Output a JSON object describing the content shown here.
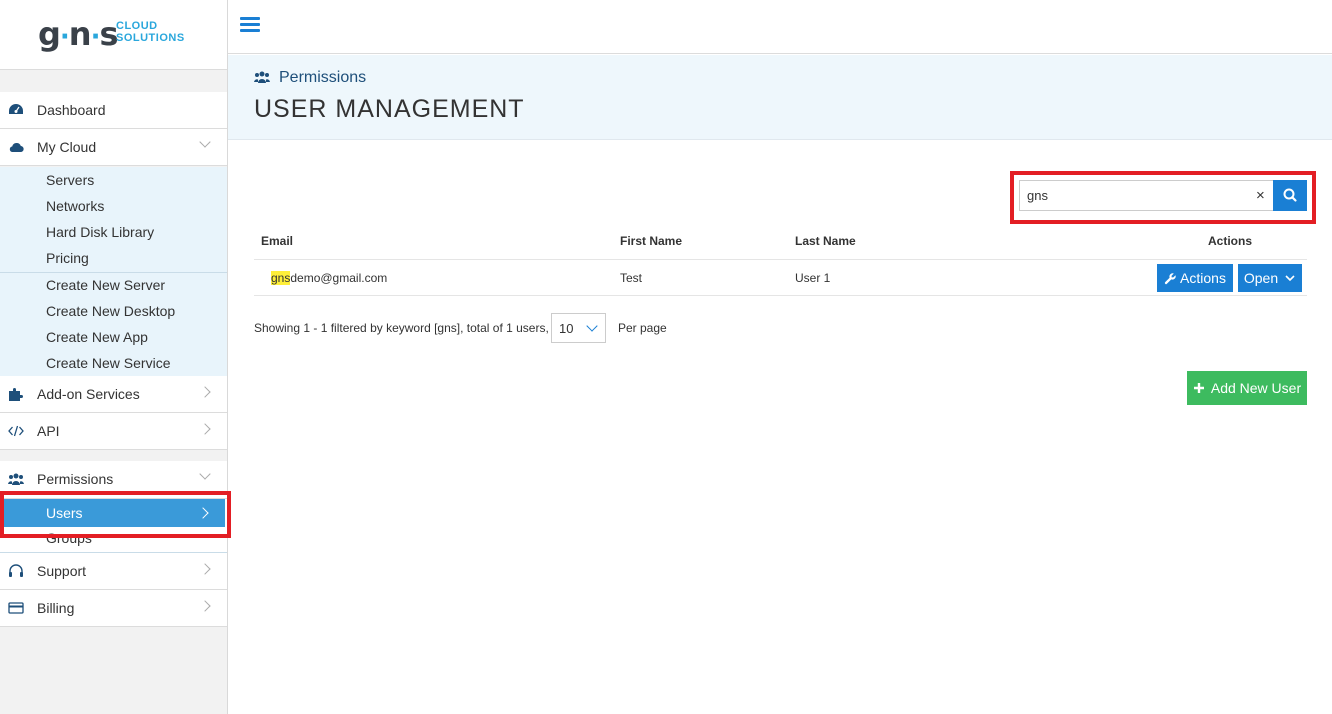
{
  "logo": {
    "brand": "gns",
    "sub1": "CLOUD",
    "sub2": "SOLUTIONS"
  },
  "sidebar": {
    "dashboard": "Dashboard",
    "my_cloud": "My Cloud",
    "cloud_items": [
      "Servers",
      "Networks",
      "Hard Disk Library",
      "Pricing"
    ],
    "create_items": [
      "Create New Server",
      "Create New Desktop",
      "Create New App",
      "Create New Service"
    ],
    "addon": "Add-on Services",
    "api": "API",
    "permissions": "Permissions",
    "users": "Users",
    "groups": "Groups",
    "support": "Support",
    "billing": "Billing"
  },
  "header": {
    "breadcrumb": "Permissions",
    "title": "USER MANAGEMENT"
  },
  "search": {
    "value": "gns",
    "clear": "×"
  },
  "table": {
    "columns": [
      "Email",
      "First Name",
      "Last Name",
      "Actions"
    ],
    "rows": [
      {
        "email_highlight": "gns",
        "email_rest": "demo@gmail.com",
        "first_name": "Test",
        "last_name": "User 1",
        "actions_label": "Actions",
        "open_label": "Open"
      }
    ]
  },
  "pagination": {
    "showing": "Showing 1 - 1 filtered by keyword [gns], total of 1 users,",
    "per_page_value": "10",
    "per_page_label": "Per page"
  },
  "add_button": "Add New User",
  "colors": {
    "primary": "#1a7fd4",
    "active_nav": "#3a9ad9",
    "success": "#3dbb5f",
    "annotation": "#e31e24",
    "highlight": "#ffef3a"
  }
}
